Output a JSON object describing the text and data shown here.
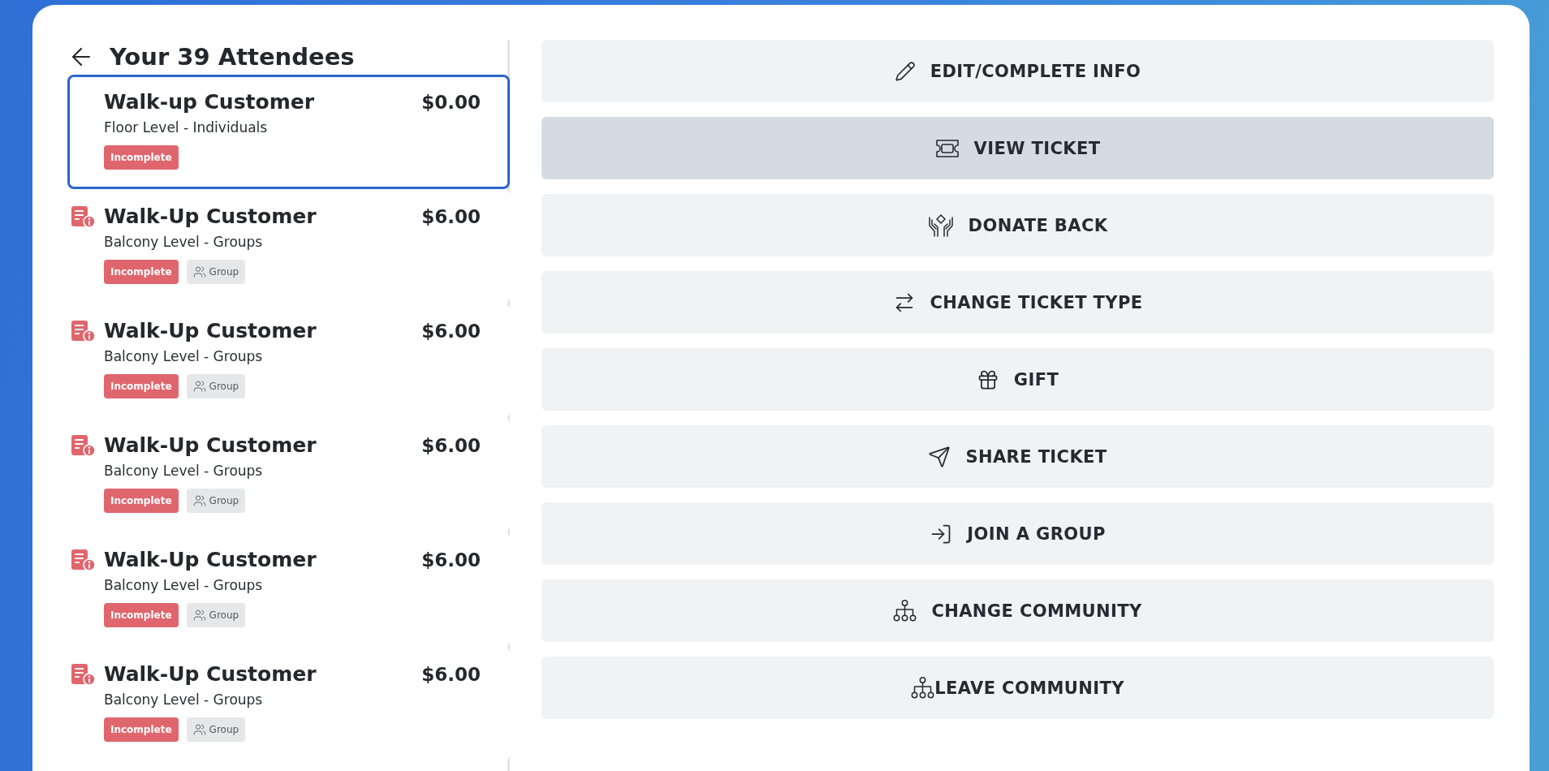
{
  "header": {
    "title": "Your 39 Attendees"
  },
  "attendees": [
    {
      "name": "Walk-up Customer",
      "ticket_type": "Floor Level - Individuals",
      "price": "$0.00",
      "selected": true,
      "alert": false,
      "tags": [
        {
          "kind": "status",
          "label": "Incomplete"
        }
      ]
    },
    {
      "name": "Walk-Up Customer",
      "ticket_type": "Balcony Level - Groups",
      "price": "$6.00",
      "selected": false,
      "alert": true,
      "tags": [
        {
          "kind": "status",
          "label": "Incomplete"
        },
        {
          "kind": "group",
          "label": "Group"
        }
      ]
    },
    {
      "name": "Walk-Up Customer",
      "ticket_type": "Balcony Level - Groups",
      "price": "$6.00",
      "selected": false,
      "alert": true,
      "tags": [
        {
          "kind": "status",
          "label": "Incomplete"
        },
        {
          "kind": "group",
          "label": "Group"
        }
      ]
    },
    {
      "name": "Walk-Up Customer",
      "ticket_type": "Balcony Level - Groups",
      "price": "$6.00",
      "selected": false,
      "alert": true,
      "tags": [
        {
          "kind": "status",
          "label": "Incomplete"
        },
        {
          "kind": "group",
          "label": "Group"
        }
      ]
    },
    {
      "name": "Walk-Up Customer",
      "ticket_type": "Balcony Level - Groups",
      "price": "$6.00",
      "selected": false,
      "alert": true,
      "tags": [
        {
          "kind": "status",
          "label": "Incomplete"
        },
        {
          "kind": "group",
          "label": "Group"
        }
      ]
    },
    {
      "name": "Walk-Up Customer",
      "ticket_type": "Balcony Level - Groups",
      "price": "$6.00",
      "selected": false,
      "alert": true,
      "tags": [
        {
          "kind": "status",
          "label": "Incomplete"
        },
        {
          "kind": "group",
          "label": "Group"
        }
      ]
    }
  ],
  "actions": [
    {
      "kind": "edit",
      "label": "EDIT/COMPLETE INFO",
      "selected": false
    },
    {
      "kind": "view",
      "label": "VIEW TICKET",
      "selected": true
    },
    {
      "kind": "donate",
      "label": "DONATE BACK",
      "selected": false
    },
    {
      "kind": "change-type",
      "label": "CHANGE TICKET TYPE",
      "selected": false
    },
    {
      "kind": "gift",
      "label": "GIFT",
      "selected": false
    },
    {
      "kind": "share",
      "label": "SHARE TICKET",
      "selected": false
    },
    {
      "kind": "join",
      "label": "JOIN A GROUP",
      "selected": false
    },
    {
      "kind": "change-community",
      "label": "CHANGE COMMUNITY",
      "selected": false
    },
    {
      "kind": "leave-community",
      "label": "LEAVE COMMUNITY",
      "selected": false
    }
  ]
}
